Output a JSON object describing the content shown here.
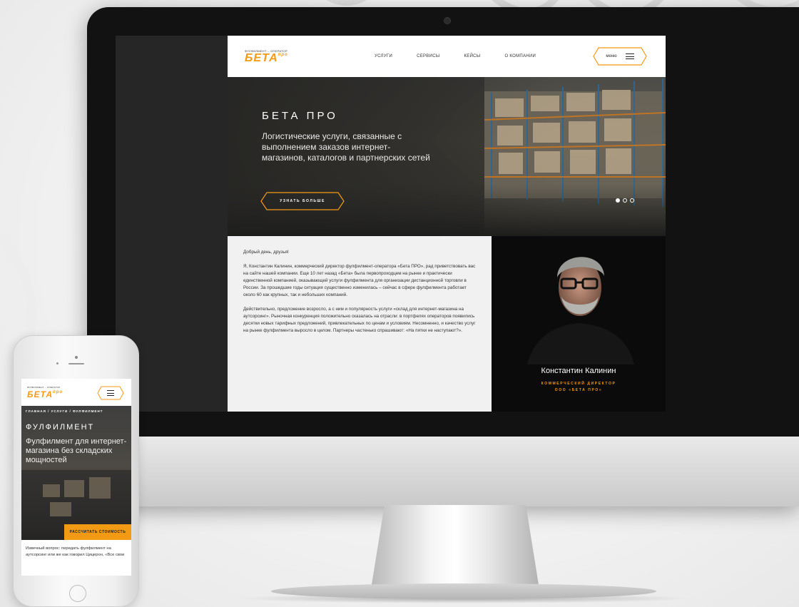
{
  "colors": {
    "accent": "#f39a14",
    "dark": "#121212",
    "hero_bg": "#3e3e3e"
  },
  "desktop": {
    "header": {
      "logo_tagline": "фулфилмент – оператор",
      "logo_text": "БЕТА",
      "logo_sup": "про",
      "nav": [
        "услуги",
        "сервисы",
        "кейсы",
        "о компании"
      ],
      "menu_label": "меню",
      "menu_icon": "hamburger-icon"
    },
    "hero": {
      "title": "БЕТА ПРО",
      "subtitle": "Логистические услуги, связанные с выполнением заказов интернет-магазинов, каталогов и партнерских сетей",
      "cta": "узнать больше",
      "slides_total": 3,
      "slide_active": 1
    },
    "letter": {
      "paragraphs": [
        "Добрый день, друзья!",
        "Я, Константин Калинин, коммерческий директор фулфилмент-оператора «Бета ПРО», рад приветствовать вас на сайте нашей компании. Еще 10 лет назад «Бета» была первопроходцем на рынке и практически единственной компанией, оказывающей услуги фулфилмента для организации дистанционной торговли в России. За прошедшие годы ситуация существенно изменилась – сейчас в сфере фулфилмента работает около 60 как крупных, так и небольших компаний.",
        "Действительно, предложение возросло, а с ним и популярность услуги «склад для интернет-магазина на аутсорсинг». Рыночная конкуренция положительно сказалась на отрасли: в портфелях операторов появились десятки новых тарифных предложений, привлекательных по ценам и условиям. Несомненно, и качество услуг на рынке фулфилмента выросло в целом. Партнеры частенько спрашивают: «На пятки не наступают?»."
      ]
    },
    "person": {
      "name": "Константин Калинин",
      "role_line1": "коммерческий директор",
      "role_line2": "ООО «Бета про»"
    }
  },
  "mobile": {
    "header": {
      "logo_tagline": "фулфилмент – оператор",
      "logo_text": "БЕТА",
      "logo_sup": "про",
      "menu_icon": "hamburger-icon"
    },
    "breadcrumb": "главная / услуги / фулфилмент",
    "hero": {
      "title": "ФУЛФИЛМЕНТ",
      "subtitle": "Фулфилмент для интернет-магазина без складских мощностей",
      "cta": "рассчитать стоимость"
    },
    "text": "Извечный вопрос: передать фулфилмент на аутсорсинг или же как говорил Цицерон, «Все свои"
  }
}
